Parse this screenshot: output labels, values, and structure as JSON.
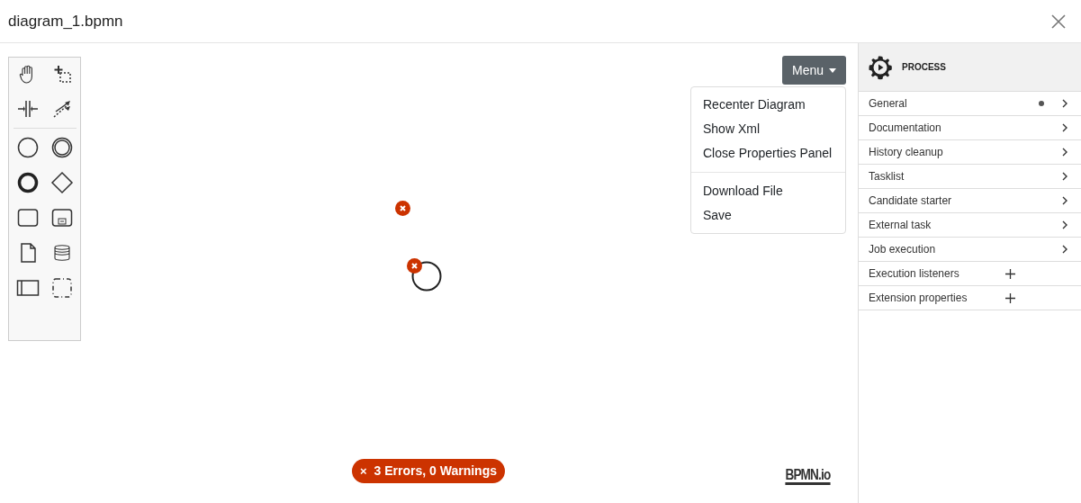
{
  "window": {
    "title": "diagram_1.bpmn"
  },
  "menu": {
    "label": "Menu",
    "expanded": true,
    "sections": [
      [
        "Recenter Diagram",
        "Show Xml",
        "Close Properties Panel"
      ],
      [
        "Download File",
        "Save"
      ]
    ]
  },
  "validation": {
    "icon": "×",
    "label": "3 Errors, 0 Warnings"
  },
  "logo": "BPMN.io",
  "properties": {
    "header": "PROCESS",
    "groups": [
      {
        "label": "General",
        "kind": "group",
        "dot": true
      },
      {
        "label": "Documentation",
        "kind": "group",
        "dot": false
      },
      {
        "label": "History cleanup",
        "kind": "group",
        "dot": false
      },
      {
        "label": "Tasklist",
        "kind": "group",
        "dot": false
      },
      {
        "label": "Candidate starter",
        "kind": "group",
        "dot": false
      },
      {
        "label": "External task",
        "kind": "group",
        "dot": false
      },
      {
        "label": "Job execution",
        "kind": "group",
        "dot": false
      },
      {
        "label": "Execution listeners",
        "kind": "list",
        "dot": false
      },
      {
        "label": "Extension properties",
        "kind": "list",
        "dot": false
      }
    ]
  }
}
